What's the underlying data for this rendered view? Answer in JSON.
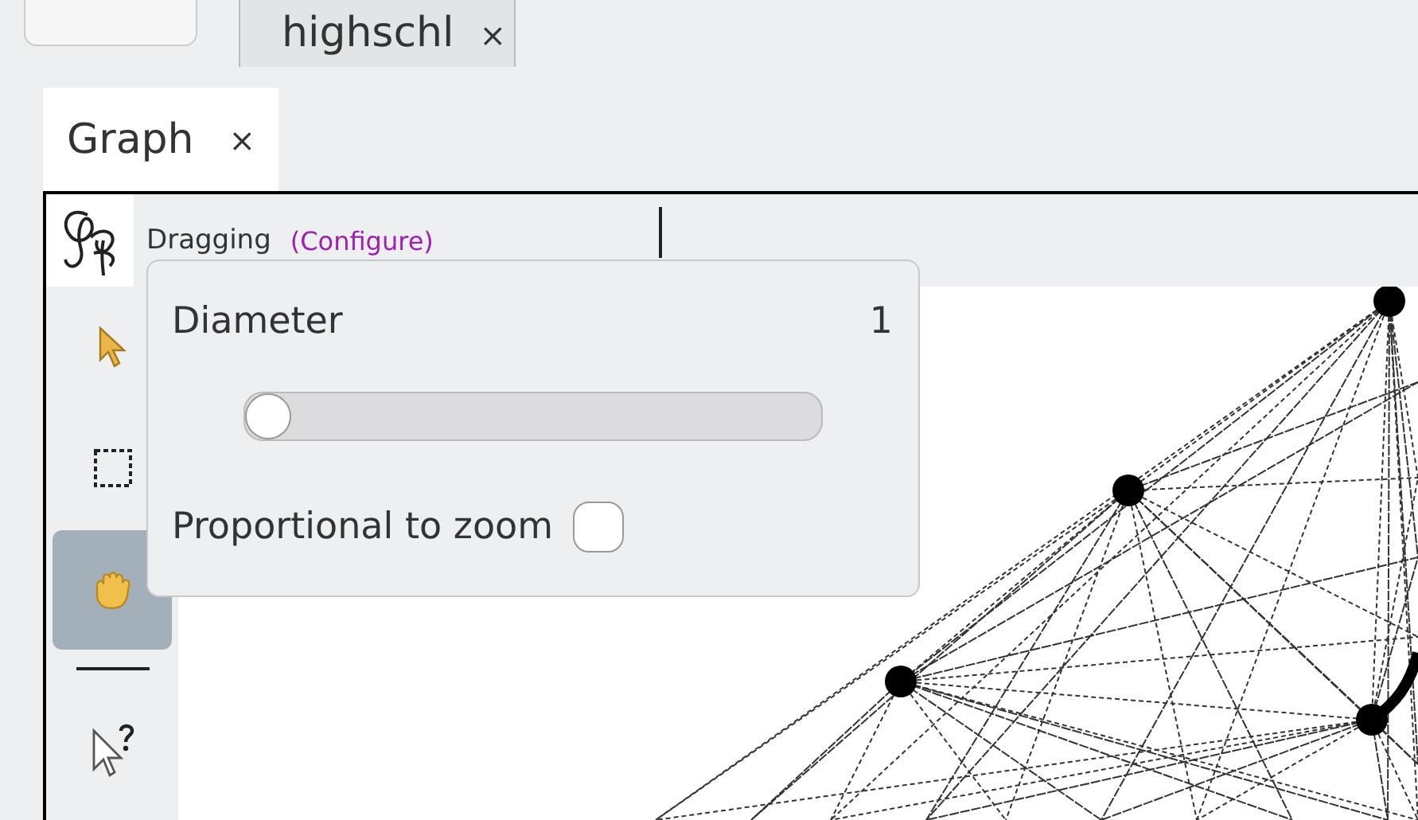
{
  "top_tabs": [
    {
      "label": "highschl",
      "close": "×",
      "selected": false
    }
  ],
  "tabs": [
    {
      "label": "Graph",
      "close": "×",
      "selected": true
    }
  ],
  "header": {
    "mode": "Dragging",
    "configure": "(Configure)"
  },
  "tools": [
    {
      "kind": "pointer",
      "selected": false
    },
    {
      "kind": "marquee",
      "selected": false
    },
    {
      "kind": "hand",
      "selected": true
    },
    {
      "kind": "separator"
    },
    {
      "kind": "help",
      "selected": false
    }
  ],
  "popup": {
    "label": "Diameter",
    "value": "1",
    "slider": {
      "level": 0
    },
    "checkbox": {
      "label": "Proportional to zoom",
      "checked": false
    }
  }
}
